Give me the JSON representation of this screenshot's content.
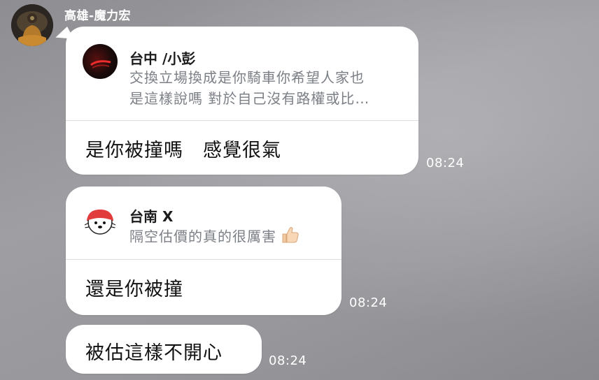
{
  "sender": {
    "name": "高雄-魔力宏"
  },
  "messages": [
    {
      "quote": {
        "author": "台中 /小彭",
        "text_line1": "交換立場換成是你騎車你希望人家也",
        "text_line2": "是這樣說嗎 對於自己沒有路權或比…"
      },
      "text": "是你被撞嗎　感覺很氣",
      "time": "08:24"
    },
    {
      "quote": {
        "author": "台南 X",
        "text_line1": "隔空估價的真的很厲害",
        "emoji": "thumbs-up-icon"
      },
      "text": "還是你被撞",
      "time": "08:24"
    },
    {
      "text": "被估這樣不開心",
      "time": "08:24"
    }
  ],
  "colors": {
    "bubble": "#ffffff",
    "quote_text": "#7b7f86",
    "divider": "#d9dde0",
    "timestamp": "#ffffff"
  }
}
